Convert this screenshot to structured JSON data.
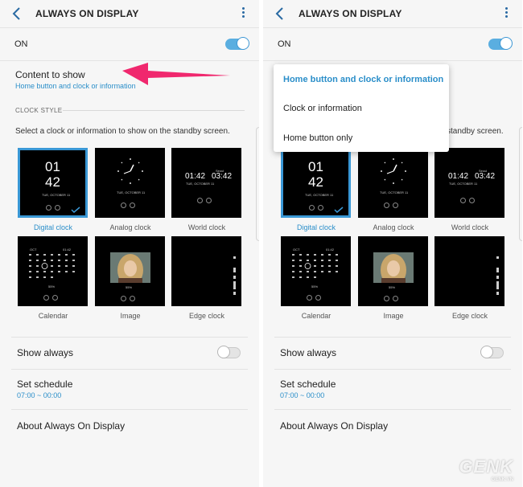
{
  "left": {
    "title": "ALWAYS ON DISPLAY",
    "on_label": "ON",
    "content_title": "Content to show",
    "content_sub": "Home button and clock or information",
    "section_header": "CLOCK STYLE",
    "description": "Select a clock or information to show on the standby screen.",
    "clocks": [
      "Digital clock",
      "Analog clock",
      "World clock",
      "Calendar",
      "Image",
      "Edge clock"
    ],
    "show_always": "Show always",
    "set_schedule": "Set schedule",
    "schedule_value": "07:00 ~ 00:00",
    "about": "About Always On Display"
  },
  "right": {
    "title": "ALWAYS ON DISPLAY",
    "on_label": "ON",
    "description_tail": "standby screen.",
    "clocks": [
      "Digital clock",
      "Analog clock",
      "World clock",
      "Calendar",
      "Image",
      "Edge clock"
    ],
    "show_always": "Show always",
    "set_schedule": "Set schedule",
    "schedule_value": "07:00 ~ 00:00",
    "about": "About Always On Display"
  },
  "dropdown": {
    "options": [
      "Home button and clock or information",
      "Clock or information",
      "Home button only"
    ],
    "selected_index": 0
  },
  "watch": {
    "digital_hour": "01",
    "digital_min": "42",
    "date": "TUE, OCTOBER 11",
    "world_a": "01:42",
    "world_b": "03:42",
    "world_city": "Seoul",
    "cal_month": "OCT",
    "cal_time": "01:42",
    "battery": "55%"
  },
  "watermark": {
    "brand": "GENK",
    "site": "GENK.VN"
  },
  "colors": {
    "accent": "#2a8ec9",
    "toggle_on": "#5aaee0",
    "arrow": "#f0286e",
    "background": "#f6f6f6"
  },
  "states": {
    "on_toggle": true,
    "show_always_toggle": false
  }
}
